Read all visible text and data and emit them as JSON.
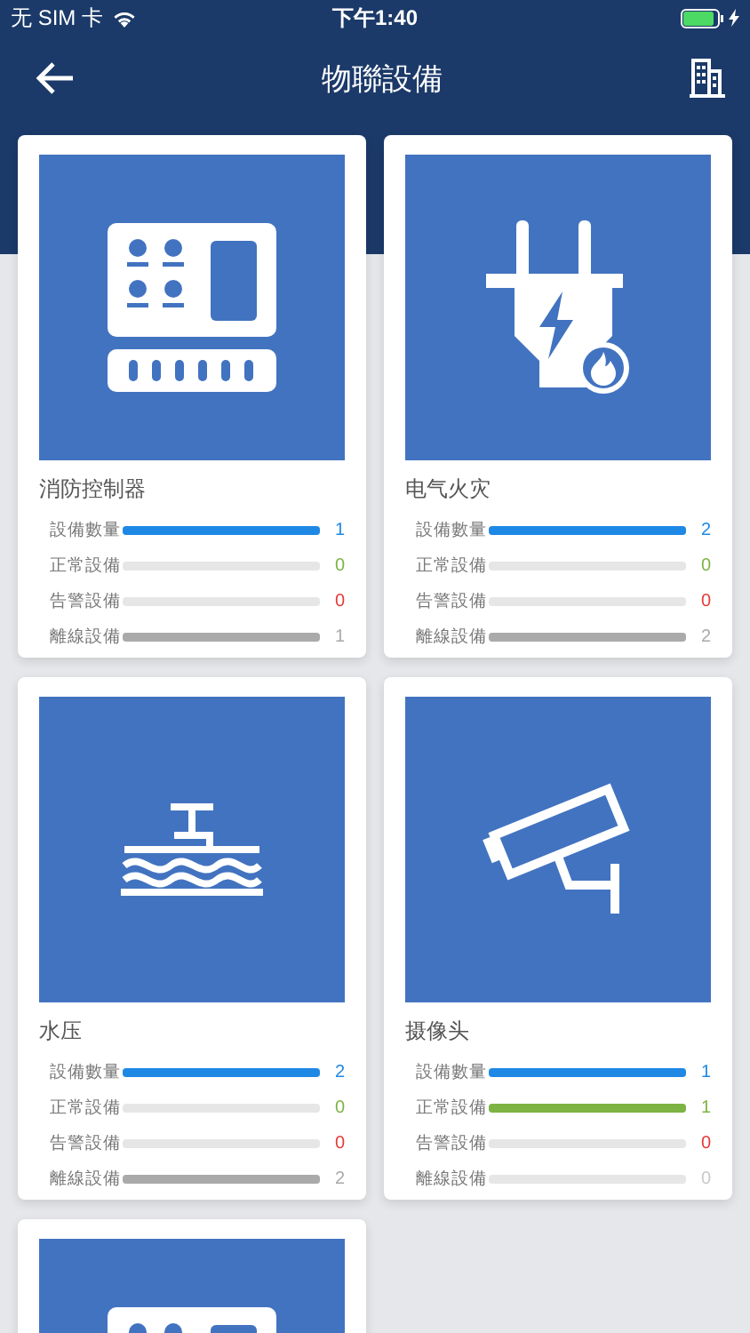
{
  "status_bar": {
    "carrier": "无 SIM 卡",
    "time": "下午1:40",
    "charging": true
  },
  "nav": {
    "title": "物聯設備"
  },
  "devices": [
    {
      "kind": "controller",
      "title": "消防控制器",
      "stats": [
        {
          "kind": "total",
          "label": "設備數量",
          "level": 1,
          "value": "1"
        },
        {
          "kind": "normal",
          "label": "正常設備",
          "level": 0,
          "value": "0"
        },
        {
          "kind": "alarm",
          "label": "告警設備",
          "level": 0,
          "value": "0"
        },
        {
          "kind": "offline",
          "label": "離線設備",
          "level": 1,
          "value": "1"
        }
      ]
    },
    {
      "kind": "electric-fire",
      "title": "电气火灾",
      "stats": [
        {
          "kind": "total",
          "label": "設備數量",
          "level": 1,
          "value": "2"
        },
        {
          "kind": "normal",
          "label": "正常設備",
          "level": 0,
          "value": "0"
        },
        {
          "kind": "alarm",
          "label": "告警設備",
          "level": 0,
          "value": "0"
        },
        {
          "kind": "offline",
          "label": "離線設備",
          "level": 1,
          "value": "2"
        }
      ]
    },
    {
      "kind": "water-pressure",
      "title": "水压",
      "stats": [
        {
          "kind": "total",
          "label": "設備數量",
          "level": 1,
          "value": "2"
        },
        {
          "kind": "normal",
          "label": "正常設備",
          "level": 0,
          "value": "0"
        },
        {
          "kind": "alarm",
          "label": "告警設備",
          "level": 0,
          "value": "0"
        },
        {
          "kind": "offline",
          "label": "離線設備",
          "level": 1,
          "value": "2"
        }
      ]
    },
    {
      "kind": "camera",
      "title": "摄像头",
      "stats": [
        {
          "kind": "total",
          "label": "設備數量",
          "level": 1,
          "value": "1"
        },
        {
          "kind": "normal",
          "label": "正常設備",
          "level": 1,
          "value": "1"
        },
        {
          "kind": "alarm",
          "label": "告警設備",
          "level": 0,
          "value": "0"
        },
        {
          "kind": "offline",
          "label": "離線設備",
          "level": 0,
          "value": "0"
        }
      ]
    },
    {
      "kind": "controller"
    }
  ]
}
